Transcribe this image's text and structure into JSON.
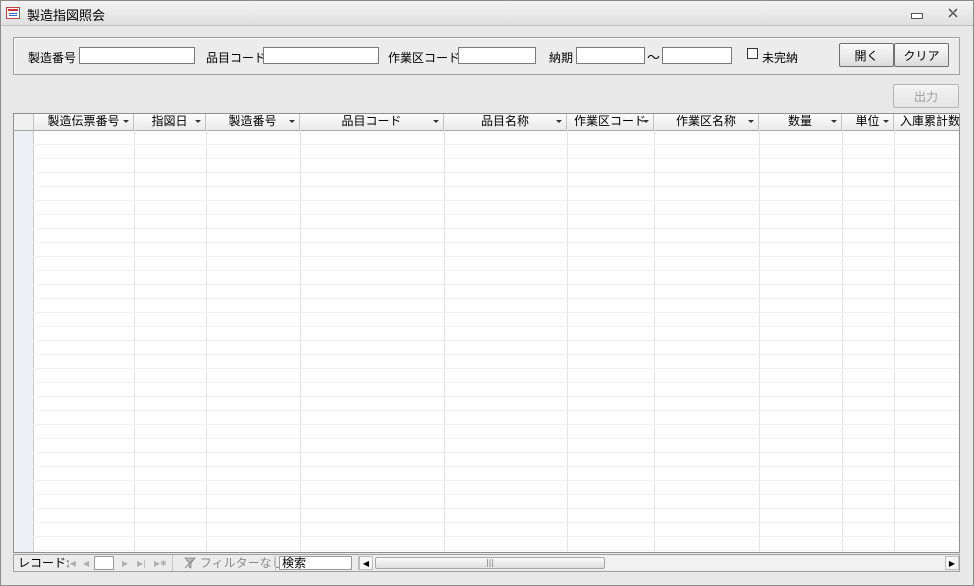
{
  "window": {
    "title": "製造指図照会"
  },
  "filters": {
    "mfg_no_label": "製造番号",
    "mfg_no_value": "",
    "item_code_label": "品目コード",
    "item_code_value": "",
    "work_area_label": "作業区コード",
    "work_area_value": "",
    "due_label": "納期",
    "due_from": "",
    "due_sep": "～",
    "due_to": "",
    "incomplete_label": "未完納",
    "incomplete_checked": false,
    "open_button": "開く",
    "clear_button": "クリア"
  },
  "toolbar": {
    "output_button": "出力"
  },
  "grid": {
    "columns": [
      {
        "label": "製造伝票番号"
      },
      {
        "label": "指図日"
      },
      {
        "label": "製造番号"
      },
      {
        "label": "品目コード"
      },
      {
        "label": "品目名称"
      },
      {
        "label": "作業区コード"
      },
      {
        "label": "作業区名称"
      },
      {
        "label": "数量"
      },
      {
        "label": "単位"
      },
      {
        "label": "入庫累計数"
      }
    ],
    "rows": []
  },
  "navigation": {
    "record_label": "レコード:",
    "record_value": "",
    "filter_label": "フィルターなし",
    "search_label": "検索"
  },
  "icons": {
    "app": "form-icon",
    "minimize": "minimize-icon",
    "close": "close-icon",
    "filter": "filter-off-icon"
  }
}
